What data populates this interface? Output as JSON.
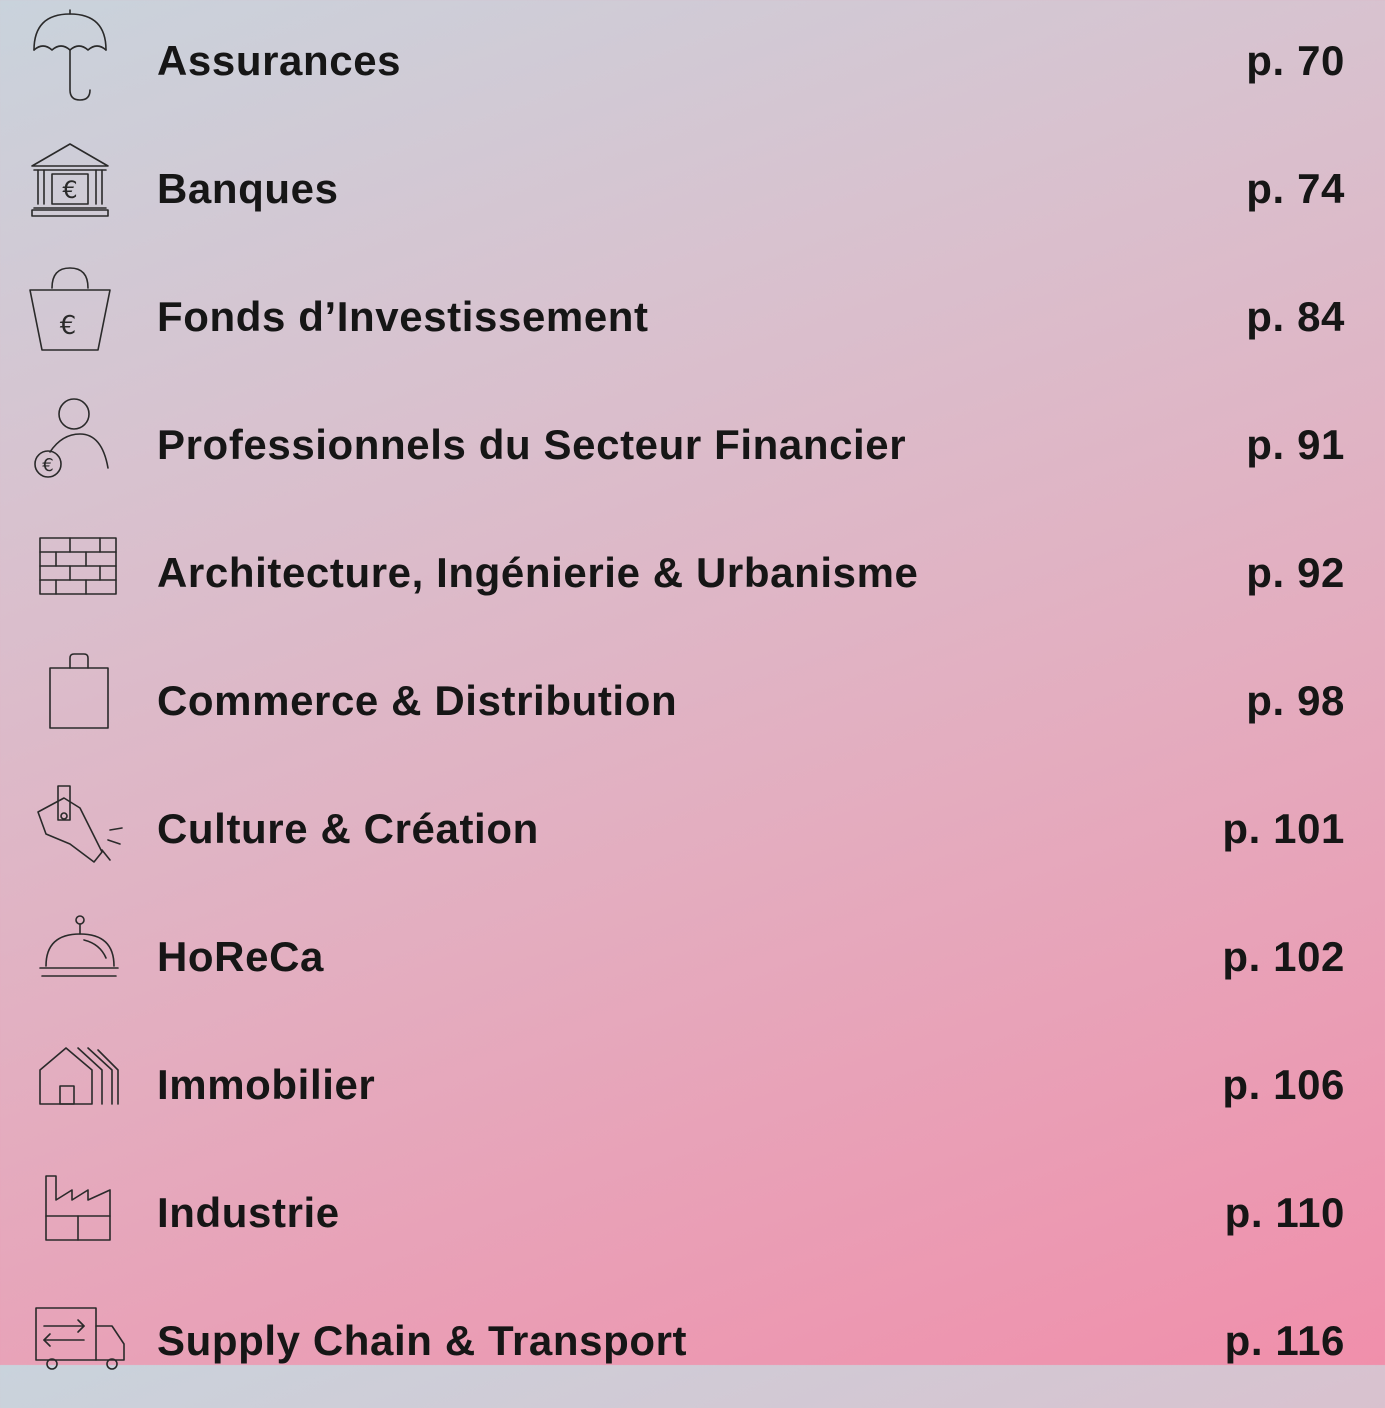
{
  "toc": [
    {
      "icon": "umbrella-icon",
      "title": "Assurances",
      "page": "p. 70"
    },
    {
      "icon": "bank-icon",
      "title": "Banques",
      "page": "p. 74"
    },
    {
      "icon": "euro-bag-icon",
      "title": "Fonds d’Investissement",
      "page": "p. 84"
    },
    {
      "icon": "person-euro-icon",
      "title": "Professionnels du Secteur Financier",
      "page": "p. 91"
    },
    {
      "icon": "brick-wall-icon",
      "title": "Architecture, Ingénierie & Urbanisme",
      "page": "p. 92"
    },
    {
      "icon": "shopping-bag-icon",
      "title": "Commerce & Distribution",
      "page": "p. 98"
    },
    {
      "icon": "megaphone-icon",
      "title": "Culture & Création",
      "page": "p. 101"
    },
    {
      "icon": "cloche-icon",
      "title": "HoReCa",
      "page": "p. 102"
    },
    {
      "icon": "house-icon",
      "title": "Immobilier",
      "page": "p. 106"
    },
    {
      "icon": "factory-icon",
      "title": "Industrie",
      "page": "p. 110"
    },
    {
      "icon": "truck-icon",
      "title": "Supply Chain & Transport",
      "page": "p. 116"
    }
  ],
  "icon_euro_symbol": "€"
}
